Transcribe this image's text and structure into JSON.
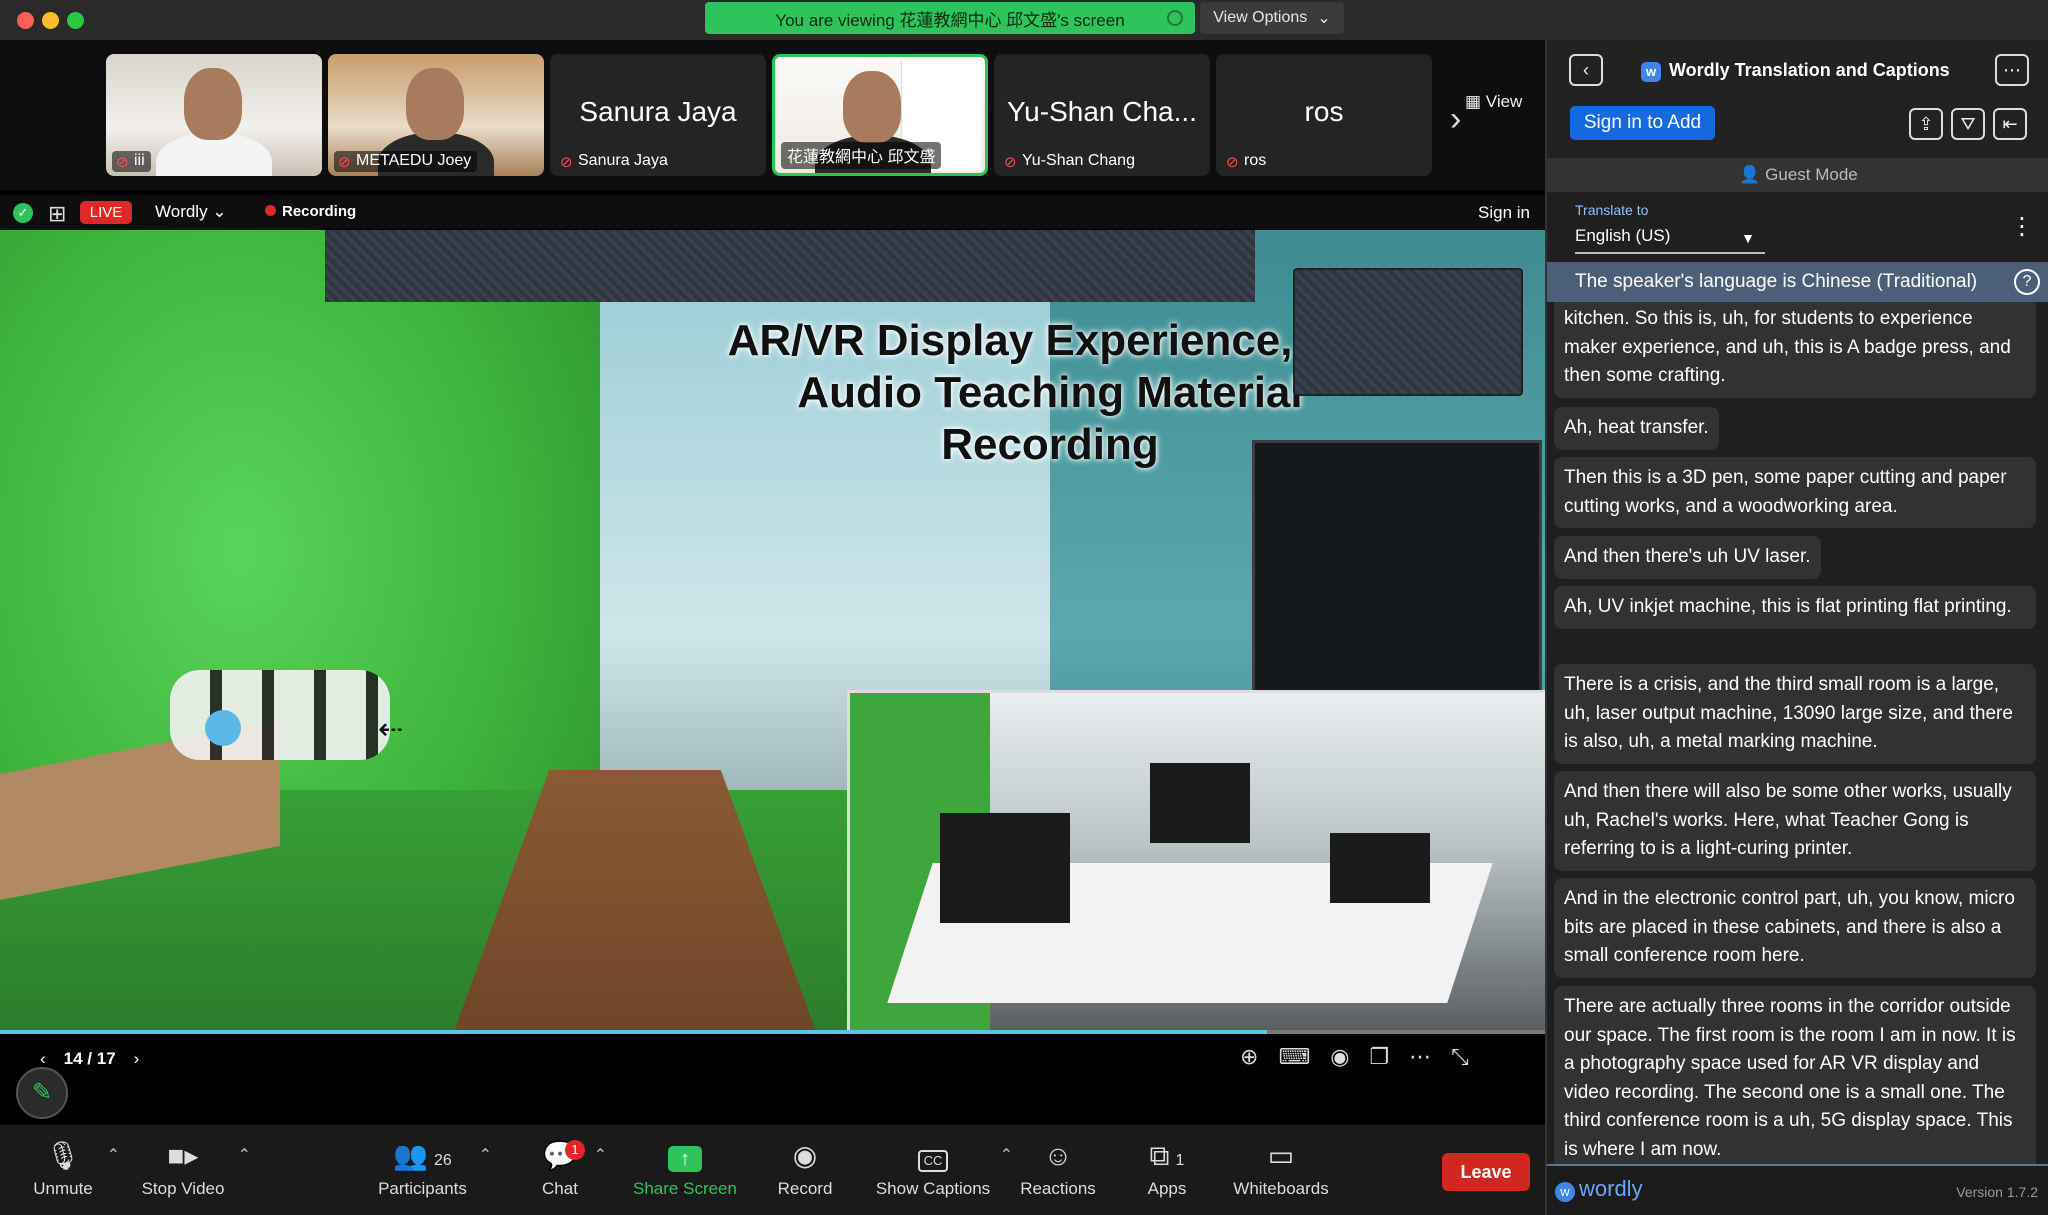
{
  "titlebar": {
    "viewing_banner": "You are viewing 花蓮教網中心 邱文盛's screen",
    "view_options": "View Options"
  },
  "thumbnails": [
    {
      "name": "iii",
      "has_video": true
    },
    {
      "name": "METAEDU Joey",
      "has_video": true
    },
    {
      "name": "Sanura Jaya",
      "big_name": "Sanura Jaya",
      "has_video": false
    },
    {
      "name": "花蓮教網中心 邱文盛",
      "has_video": true,
      "active": true
    },
    {
      "name": "Yu-Shan Chang",
      "big_name": "Yu-Shan Cha...",
      "has_video": false
    },
    {
      "name": "ros",
      "big_name": "ros",
      "has_video": false
    }
  ],
  "strip": {
    "view_label": "View"
  },
  "status": {
    "live": "LIVE",
    "stream_target": "Wordly",
    "recording": "Recording",
    "sign_in": "Sign in"
  },
  "screen": {
    "overlay_title_line1": "AR/VR Display Experience, Vid",
    "overlay_title_line2": "Audio Teaching Material Recording",
    "page_indicator": "14 / 17",
    "progress_fraction": 0.82
  },
  "toolbar": {
    "unmute": "Unmute",
    "stop_video": "Stop Video",
    "participants": "Participants",
    "participants_count": "26",
    "chat": "Chat",
    "chat_badge": "1",
    "share_screen": "Share Screen",
    "record": "Record",
    "show_captions": "Show Captions",
    "captions_icon": "CC",
    "reactions": "Reactions",
    "apps": "Apps",
    "apps_count": "1",
    "whiteboards": "Whiteboards",
    "leave": "Leave"
  },
  "panel": {
    "title": "Wordly Translation and Captions",
    "sign_in_add": "Sign in to Add",
    "guest_mode": "Guest Mode",
    "translate_to_label": "Translate to",
    "language": "English (US)",
    "speaker_language": "The speaker's language is Chinese (Traditional)",
    "captions": [
      "kitchen. So this is, uh, for students to experience maker experience, and uh, this is A badge press, and then some crafting.",
      "Ah, heat transfer.",
      "Then this is a 3D pen, some paper cutting and paper cutting works, and a woodworking area.",
      "And then there's uh UV laser.",
      "Ah, UV inkjet machine, this is flat printing flat printing.",
      "There is a crisis, and the third small room is a large, uh, laser output machine, 13090 large size, and there is also, uh, a metal marking machine.",
      "And then there will also be some other works, usually uh, Rachel's works. Here, what Teacher Gong is referring to is a light-curing printer.",
      "And in the electronic control part, uh, you know, micro bits are placed in these cabinets, and there is also a small conference room here.",
      "There are actually three rooms in the corridor outside our space. The first room is the room I am in now. It is a photography space used for AR VR display and video recording. The second one is a small one. The third conference room is a uh, 5G display space. This is where I am now."
    ],
    "brand": "wordly",
    "version": "Version 1.7.2"
  }
}
